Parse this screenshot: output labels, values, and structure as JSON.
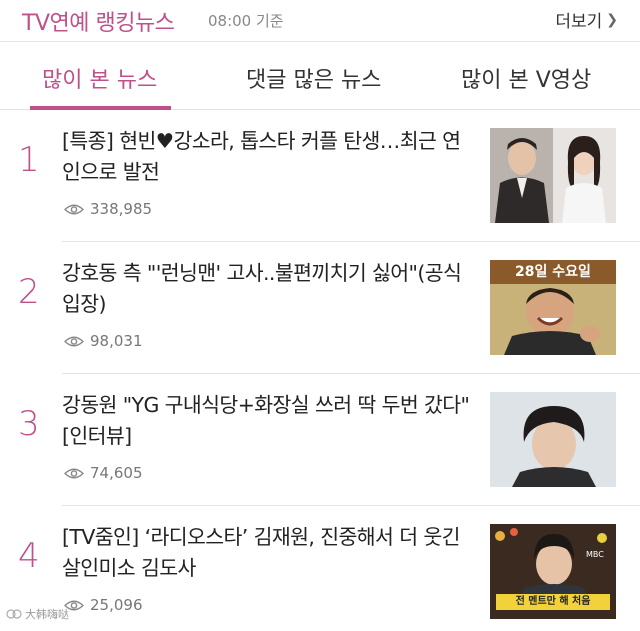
{
  "header": {
    "title": "TV연예 랭킹뉴스",
    "time": "08:00 기준",
    "more_label": "더보기",
    "accent_color": "#c0508a"
  },
  "tabs": [
    {
      "label": "많이 본 뉴스",
      "active": true
    },
    {
      "label": "댓글 많은 뉴스",
      "active": false
    },
    {
      "label": "많이 본 V영상",
      "active": false
    }
  ],
  "items": [
    {
      "rank": "1",
      "title": "[특종] 현빈♥강소라, 톱스타 커플 탄생…최근 연인으로 발전",
      "views": "338,985"
    },
    {
      "rank": "2",
      "title": "강호동 측 \"'런닝맨' 고사..불편끼치기 싫어\"(공식입장)",
      "views": "98,031"
    },
    {
      "rank": "3",
      "title": "강동원 \"YG 구내식당+화장실 쓰러 딱 두번 갔다\"[인터뷰]",
      "views": "74,605"
    },
    {
      "rank": "4",
      "title": "[TV줌인] ‘라디오스타’ 김재원, 진중해서 더 웃긴 살인미소 김도사",
      "views": "25,096"
    }
  ],
  "thumb_texts": {
    "item2_banner": "28일 수요일",
    "item4_caption": "전 멘트만 해 처음",
    "item4_logo": "MBC"
  },
  "watermark": "大韩嗨哒"
}
